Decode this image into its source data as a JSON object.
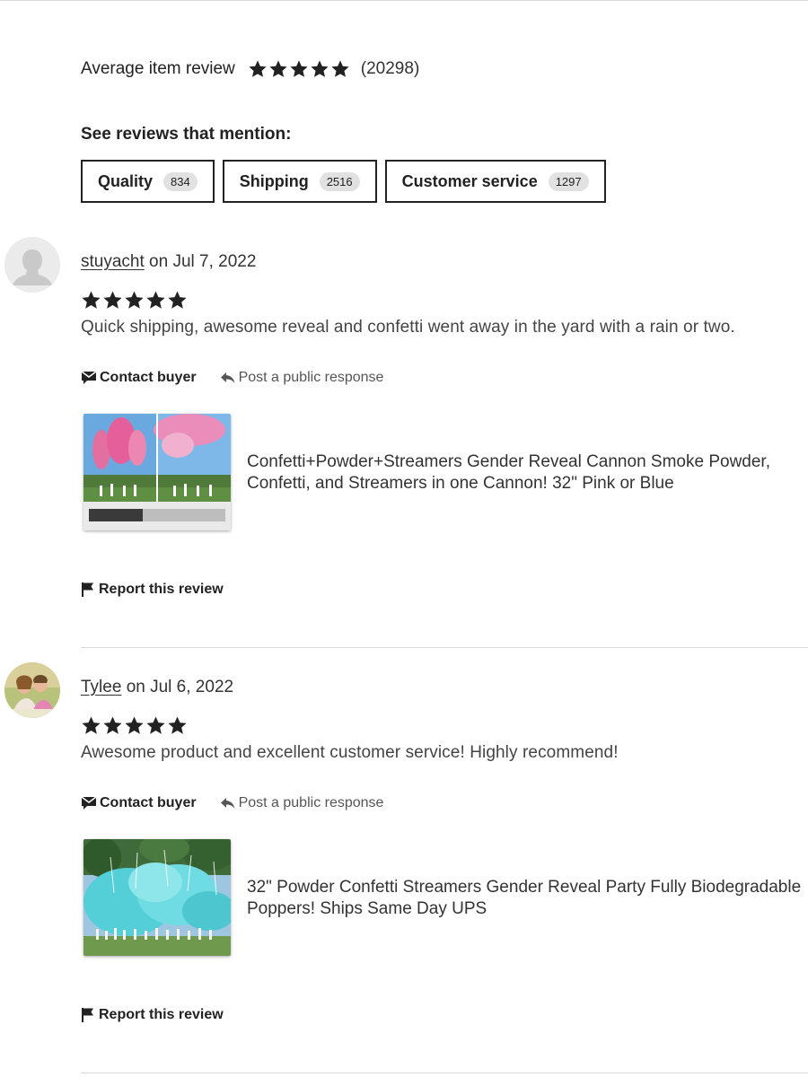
{
  "summary": {
    "label": "Average item review",
    "rating": 5,
    "count": "(20298)"
  },
  "mentions": {
    "title": "See reviews that mention:",
    "chips": [
      {
        "label": "Quality",
        "count": "834"
      },
      {
        "label": "Shipping",
        "count": "2516"
      },
      {
        "label": "Customer service",
        "count": "1297"
      }
    ]
  },
  "actions": {
    "contact": "Contact buyer",
    "post": "Post a public response",
    "report": "Report this review"
  },
  "reviews": [
    {
      "user": "stuyacht",
      "date_text": " on Jul 7, 2022",
      "rating": 5,
      "text": "Quick shipping, awesome reveal and confetti went away in the yard with a rain or two.",
      "product_title": "Confetti+Powder+Streamers Gender Reveal Cannon Smoke Powder, Confetti, and Streamers in one Cannon! 32\" Pink or Blue",
      "product_image": "pink-smoke-cannon-photo",
      "avatar": "default-silhouette"
    },
    {
      "user": "Tylee",
      "date_text": " on Jul 6, 2022",
      "rating": 5,
      "text": "Awesome product and excellent customer service! Highly recommend!",
      "product_title": "32\" Powder Confetti Streamers Gender Reveal Party Fully Biodegradable Poppers! Ships Same Day UPS",
      "product_image": "blue-smoke-cannon-photo",
      "avatar": "couple-photo"
    }
  ],
  "colors": {
    "text": "#222222",
    "muted": "#555555",
    "chip_count_bg": "#e1e1e1",
    "divider": "#d9d9d9",
    "pink": "#e77fa6",
    "blue": "#5fd3dc"
  }
}
